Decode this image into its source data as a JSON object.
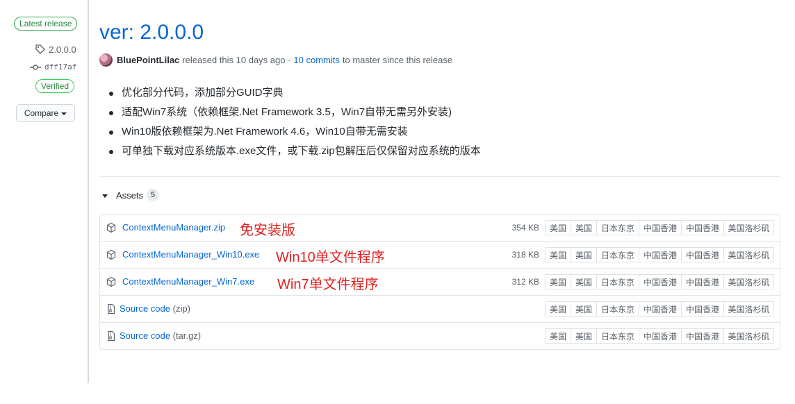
{
  "sidebar": {
    "latest_badge": "Latest release",
    "tag": "2.0.0.0",
    "commit": "dff17af",
    "verified": "Verified",
    "compare": "Compare"
  },
  "release": {
    "title": "ver: 2.0.0.0",
    "author": "BluePointLilac",
    "released_text": "released this 10 days ago ·",
    "commits_link": "10 commits",
    "since_text": "to master since this release"
  },
  "notes": [
    "优化部分代码，添加部分GUID字典",
    "适配Win7系统（依赖框架.Net Framework 3.5，Win7自带无需另外安装)",
    "Win10版依赖框架为.Net Framework 4.6，Win10自带无需安装",
    "可单独下载对应系统版本.exe文件，或下载.zip包解压后仅保留对应系统的版本"
  ],
  "assets_section": {
    "label": "Assets",
    "count": "5"
  },
  "mirrors": [
    "美国",
    "美国",
    "日本东京",
    "中国香港",
    "中国香港",
    "美国洛杉矶"
  ],
  "assets": [
    {
      "name": "ContextMenuManager.zip",
      "note": "免安装版",
      "size": "354 KB"
    },
    {
      "name": "ContextMenuManager_Win10.exe",
      "note": "Win10单文件程序",
      "size": "318 KB"
    },
    {
      "name": "ContextMenuManager_Win7.exe",
      "note": "Win7单文件程序",
      "size": "312 KB"
    },
    {
      "name": "Source code",
      "ext": "(zip)"
    },
    {
      "name": "Source code",
      "ext": "(tar.gz)"
    }
  ],
  "colors": {
    "link": "#0366d6",
    "annotation": "#e02020",
    "verified": "#22863a"
  },
  "icons": {
    "package": "package-icon",
    "file_zip": "file-zip-icon",
    "tag": "tag-icon",
    "commit": "git-commit-icon"
  }
}
